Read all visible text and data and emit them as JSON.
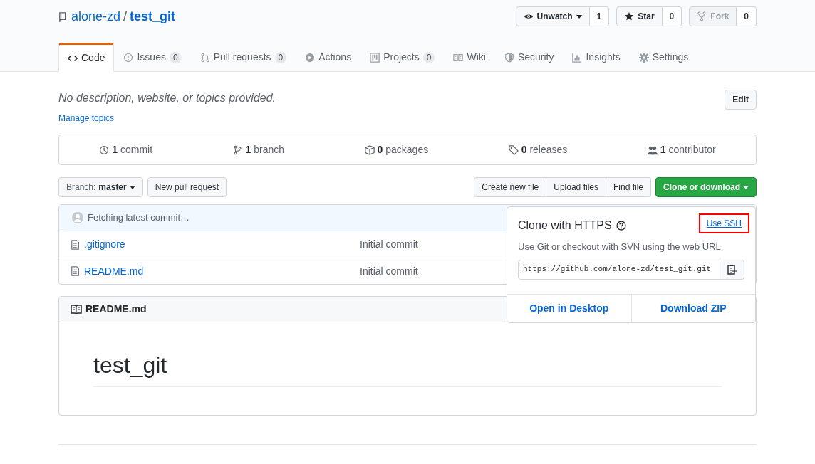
{
  "repo": {
    "owner": "alone-zd",
    "separator": "/",
    "name": "test_git"
  },
  "actions": [
    {
      "kind": "watch",
      "label": "Unwatch",
      "count": "1",
      "disabled": false
    },
    {
      "kind": "star",
      "label": "Star",
      "count": "0",
      "disabled": false
    },
    {
      "kind": "fork",
      "label": "Fork",
      "count": "0",
      "disabled": true
    }
  ],
  "tabs": [
    {
      "kind": "code",
      "label": "Code",
      "selected": true
    },
    {
      "kind": "issues",
      "label": "Issues",
      "count": "0",
      "selected": false
    },
    {
      "kind": "pulls",
      "label": "Pull requests",
      "count": "0",
      "selected": false
    },
    {
      "kind": "actions",
      "label": "Actions",
      "selected": false
    },
    {
      "kind": "projects",
      "label": "Projects",
      "count": "0",
      "selected": false
    },
    {
      "kind": "wiki",
      "label": "Wiki",
      "selected": false
    },
    {
      "kind": "security",
      "label": "Security",
      "selected": false
    },
    {
      "kind": "insights",
      "label": "Insights",
      "selected": false
    },
    {
      "kind": "settings",
      "label": "Settings",
      "selected": false
    }
  ],
  "description": "No description, website, or topics provided.",
  "edit_button": "Edit",
  "manage_topics": "Manage topics",
  "stats": [
    {
      "kind": "commits",
      "number": "1",
      "label": "commit"
    },
    {
      "kind": "branches",
      "number": "1",
      "label": "branch"
    },
    {
      "kind": "packages",
      "number": "0",
      "label": "packages"
    },
    {
      "kind": "releases",
      "number": "0",
      "label": "releases"
    },
    {
      "kind": "contributors",
      "number": "1",
      "label": "contributor"
    }
  ],
  "branch": {
    "label": "Branch:",
    "value": "master"
  },
  "new_pull_request": "New pull request",
  "file_buttons": [
    "Create new file",
    "Upload files",
    "Find file"
  ],
  "clone_button": "Clone or download",
  "commit_status": "Fetching latest commit…",
  "files": [
    {
      "name": ".gitignore",
      "message": "Initial commit"
    },
    {
      "name": "README.md",
      "message": "Initial commit"
    }
  ],
  "readme": {
    "title": "README.md",
    "heading": "test_git"
  },
  "clone_popup": {
    "title": "Clone with HTTPS",
    "switch_link": "Use SSH",
    "switch_highlighted": true,
    "hint": "Use Git or checkout with SVN using the web URL.",
    "url": "https://github.com/alone-zd/test_git.git",
    "options": [
      "Open in Desktop",
      "Download ZIP"
    ]
  }
}
